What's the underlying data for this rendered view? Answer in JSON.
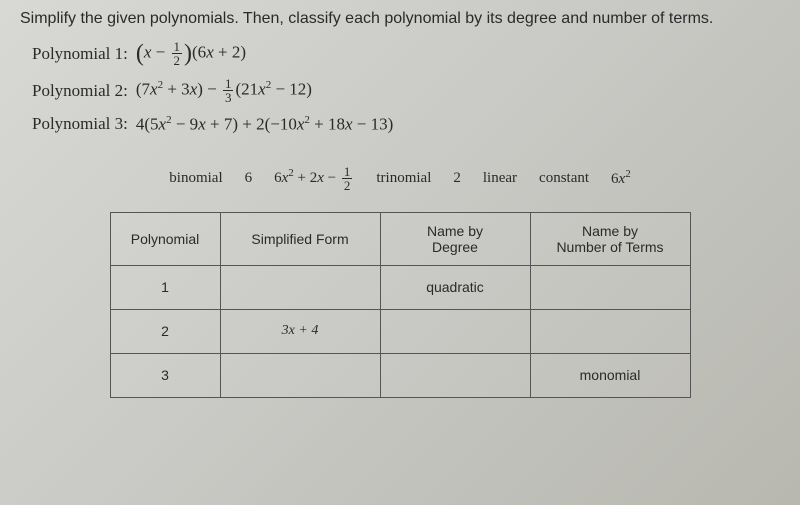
{
  "instruction": "Simplify the given polynomials. Then, classify each polynomial by its degree and number of terms.",
  "polynomials": {
    "p1_label": "Polynomial 1:",
    "p2_label": "Polynomial 2:",
    "p3_label": "Polynomial 3:"
  },
  "word_bank": {
    "w1": "binomial",
    "w2": "6",
    "w4": "trinomial",
    "w5": "2",
    "w6": "linear",
    "w7": "constant"
  },
  "table": {
    "headers": {
      "h1": "Polynomial",
      "h2": "Simplified Form",
      "h3_line1": "Name by",
      "h3_line2": "Degree",
      "h4_line1": "Name by",
      "h4_line2": "Number of Terms"
    },
    "rows": [
      {
        "num": "1",
        "form": "",
        "degree": "quadratic",
        "terms": ""
      },
      {
        "num": "2",
        "form": "3x + 4",
        "degree": "",
        "terms": ""
      },
      {
        "num": "3",
        "form": "",
        "degree": "",
        "terms": "monomial"
      }
    ]
  },
  "chart_data": {
    "type": "table",
    "title": "Polynomial classification worksheet",
    "polynomials": [
      {
        "id": 1,
        "expression": "(x - 1/2)(6x + 2)"
      },
      {
        "id": 2,
        "expression": "(7x^2 + 3x) - (1/3)(21x^2 - 12)"
      },
      {
        "id": 3,
        "expression": "4(5x^2 - 9x + 7) + 2(-10x^2 + 18x - 13)"
      }
    ],
    "word_bank": [
      "binomial",
      "6",
      "6x^2 + 2x - 1/2",
      "trinomial",
      "2",
      "linear",
      "constant",
      "6x^2"
    ],
    "rows": [
      {
        "polynomial": 1,
        "simplified_form": "",
        "name_by_degree": "quadratic",
        "name_by_terms": ""
      },
      {
        "polynomial": 2,
        "simplified_form": "3x + 4",
        "name_by_degree": "",
        "name_by_terms": ""
      },
      {
        "polynomial": 3,
        "simplified_form": "",
        "name_by_degree": "",
        "name_by_terms": "monomial"
      }
    ]
  }
}
